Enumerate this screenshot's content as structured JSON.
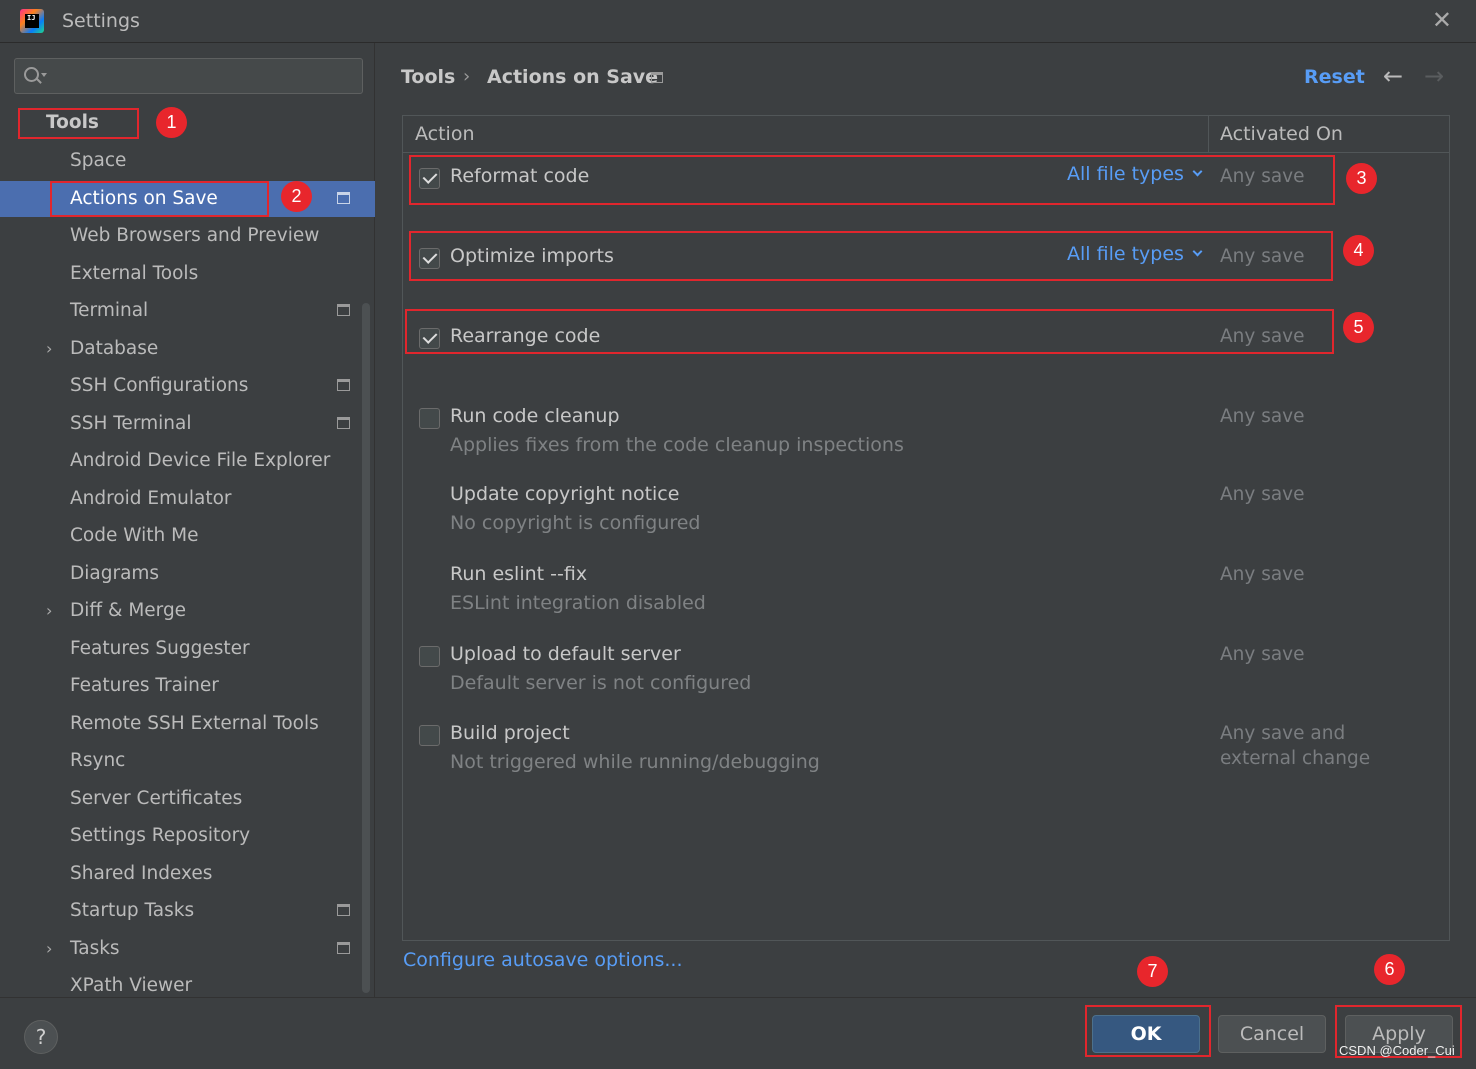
{
  "window": {
    "title": "Settings",
    "logo_text": "IJ"
  },
  "sidebar": {
    "search": {
      "value": "",
      "placeholder": ""
    },
    "root": {
      "label": "Tools"
    },
    "items": [
      {
        "label": "Space",
        "expandable": false,
        "icon": false,
        "selected": false
      },
      {
        "label": "Actions on Save",
        "expandable": false,
        "icon": true,
        "selected": true
      },
      {
        "label": "Web Browsers and Preview",
        "expandable": false,
        "icon": false,
        "selected": false
      },
      {
        "label": "External Tools",
        "expandable": false,
        "icon": false,
        "selected": false
      },
      {
        "label": "Terminal",
        "expandable": false,
        "icon": true,
        "selected": false
      },
      {
        "label": "Database",
        "expandable": true,
        "icon": false,
        "selected": false
      },
      {
        "label": "SSH Configurations",
        "expandable": false,
        "icon": true,
        "selected": false
      },
      {
        "label": "SSH Terminal",
        "expandable": false,
        "icon": true,
        "selected": false
      },
      {
        "label": "Android Device File Explorer",
        "expandable": false,
        "icon": false,
        "selected": false
      },
      {
        "label": "Android Emulator",
        "expandable": false,
        "icon": false,
        "selected": false
      },
      {
        "label": "Code With Me",
        "expandable": false,
        "icon": false,
        "selected": false
      },
      {
        "label": "Diagrams",
        "expandable": false,
        "icon": false,
        "selected": false
      },
      {
        "label": "Diff & Merge",
        "expandable": true,
        "icon": false,
        "selected": false
      },
      {
        "label": "Features Suggester",
        "expandable": false,
        "icon": false,
        "selected": false
      },
      {
        "label": "Features Trainer",
        "expandable": false,
        "icon": false,
        "selected": false
      },
      {
        "label": "Remote SSH External Tools",
        "expandable": false,
        "icon": false,
        "selected": false
      },
      {
        "label": "Rsync",
        "expandable": false,
        "icon": false,
        "selected": false
      },
      {
        "label": "Server Certificates",
        "expandable": false,
        "icon": false,
        "selected": false
      },
      {
        "label": "Settings Repository",
        "expandable": false,
        "icon": false,
        "selected": false
      },
      {
        "label": "Shared Indexes",
        "expandable": false,
        "icon": false,
        "selected": false
      },
      {
        "label": "Startup Tasks",
        "expandable": false,
        "icon": true,
        "selected": false
      },
      {
        "label": "Tasks",
        "expandable": true,
        "icon": true,
        "selected": false
      },
      {
        "label": "XPath Viewer",
        "expandable": false,
        "icon": false,
        "selected": false
      }
    ]
  },
  "header": {
    "breadcrumb_root": "Tools",
    "breadcrumb_sep": "›",
    "breadcrumb_page": "Actions on Save",
    "reset_label": "Reset",
    "back_icon": "←",
    "forward_icon": "→"
  },
  "table": {
    "col_action": "Action",
    "col_activated": "Activated On",
    "rows": [
      {
        "title": "Reformat code",
        "desc": "",
        "checkbox": true,
        "checked": true,
        "file_types": "All file types",
        "activated": "Any save"
      },
      {
        "title": "Optimize imports",
        "desc": "",
        "checkbox": true,
        "checked": true,
        "file_types": "All file types",
        "activated": "Any save"
      },
      {
        "title": "Rearrange code",
        "desc": "",
        "checkbox": true,
        "checked": true,
        "file_types": "",
        "activated": "Any save"
      },
      {
        "title": "Run code cleanup",
        "desc": "Applies fixes from the code cleanup inspections",
        "checkbox": true,
        "checked": false,
        "file_types": "",
        "activated": "Any save"
      },
      {
        "title": "Update copyright notice",
        "desc": "No copyright is configured",
        "checkbox": false,
        "checked": false,
        "file_types": "",
        "activated": "Any save"
      },
      {
        "title": "Run eslint --fix",
        "desc": "ESLint integration disabled",
        "checkbox": false,
        "checked": false,
        "file_types": "",
        "activated": "Any save"
      },
      {
        "title": "Upload to default server",
        "desc": "Default server is not configured",
        "checkbox": true,
        "checked": false,
        "file_types": "",
        "activated": "Any save"
      },
      {
        "title": "Build project",
        "desc": "Not triggered while running/debugging",
        "checkbox": true,
        "checked": false,
        "file_types": "",
        "activated": "Any save and\nexternal change"
      }
    ]
  },
  "footer": {
    "configure_link": "Configure autosave options...",
    "help_label": "?",
    "ok_label": "OK",
    "cancel_label": "Cancel",
    "apply_label": "Apply"
  },
  "annotations": [
    "1",
    "2",
    "3",
    "4",
    "5",
    "6",
    "7"
  ],
  "watermark": "CSDN @Coder_Cui",
  "colors": {
    "background": "#3c3f41",
    "selection": "#4b6eaf",
    "link": "#589df6",
    "primary_button": "#365880",
    "annotation_red": "#e1262d"
  }
}
